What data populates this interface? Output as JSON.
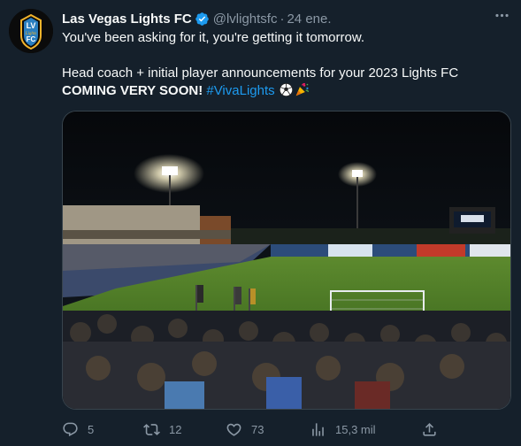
{
  "tweet": {
    "display_name": "Las Vegas Lights FC",
    "handle": "@lvlightsfc",
    "separator": "·",
    "date": "24 ene.",
    "line1": "You've been asking for it, you're getting it tomorrow.",
    "line2_text": "Head coach + initial player announcements for your 2023 Lights FC ",
    "line2_emphasis": "COMING VERY SOON!",
    "hashtag": "#VivaLights",
    "emojis": [
      "soccer-ball-emoji",
      "party-popper-emoji"
    ]
  },
  "avatar": {
    "logo_text": "LV",
    "logo_script": "Lights",
    "logo_text2": "FC"
  },
  "actions": {
    "replies": "5",
    "retweets": "12",
    "likes": "73",
    "views": "15,3 mil"
  },
  "colors": {
    "background": "#15202b",
    "text": "#f7f9f9",
    "muted": "#8b98a5",
    "link": "#1d9bf0",
    "verified": "#1d9bf0",
    "border": "#38444d"
  }
}
